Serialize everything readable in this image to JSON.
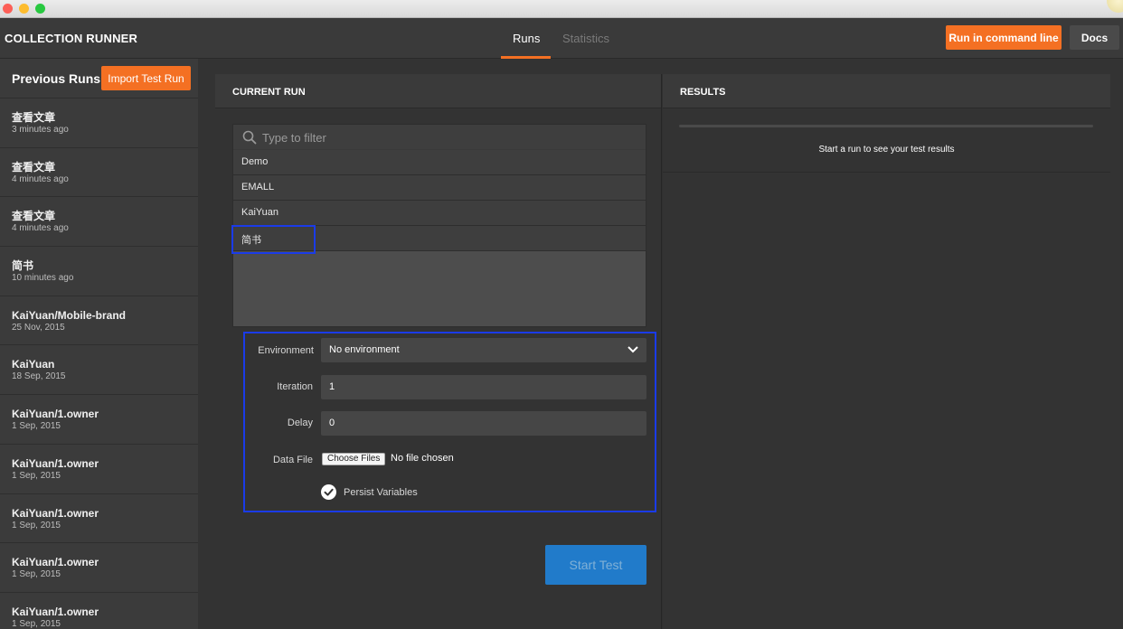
{
  "header": {
    "app_title": "COLLECTION RUNNER",
    "tabs": [
      {
        "label": "Runs",
        "active": true
      },
      {
        "label": "Statistics",
        "active": false
      }
    ],
    "run_cmd_label": "Run in command line",
    "docs_label": "Docs"
  },
  "sidebar": {
    "title": "Previous Runs",
    "import_label": "Import Test Run",
    "runs": [
      {
        "name": "查看文章",
        "time": "3 minutes ago"
      },
      {
        "name": "查看文章",
        "time": "4 minutes ago"
      },
      {
        "name": "查看文章",
        "time": "4 minutes ago"
      },
      {
        "name": "简书",
        "time": "10 minutes ago"
      },
      {
        "name": "KaiYuan/Mobile-brand",
        "time": "25 Nov, 2015"
      },
      {
        "name": "KaiYuan",
        "time": "18 Sep, 2015"
      },
      {
        "name": "KaiYuan/1.owner",
        "time": "1 Sep, 2015"
      },
      {
        "name": "KaiYuan/1.owner",
        "time": "1 Sep, 2015"
      },
      {
        "name": "KaiYuan/1.owner",
        "time": "1 Sep, 2015"
      },
      {
        "name": "KaiYuan/1.owner",
        "time": "1 Sep, 2015"
      },
      {
        "name": "KaiYuan/1.owner",
        "time": "1 Sep, 2015"
      }
    ]
  },
  "current_run": {
    "title": "CURRENT RUN",
    "filter_placeholder": "Type to filter",
    "collections": [
      "Demo",
      "EMALL",
      "KaiYuan",
      "简书"
    ],
    "environment_label": "Environment",
    "environment_value": "No environment",
    "iteration_label": "Iteration",
    "iteration_value": "1",
    "delay_label": "Delay",
    "delay_value": "0",
    "datafile_label": "Data File",
    "choose_files_label": "Choose Files",
    "file_status": "No file chosen",
    "persist_label": "Persist Variables",
    "persist_checked": true,
    "start_label": "Start Test"
  },
  "results": {
    "title": "RESULTS",
    "message": "Start a run to see your test results"
  },
  "colors": {
    "accent": "#f47023",
    "highlight_border": "#1a3be8",
    "start_button": "#1e88e5"
  }
}
